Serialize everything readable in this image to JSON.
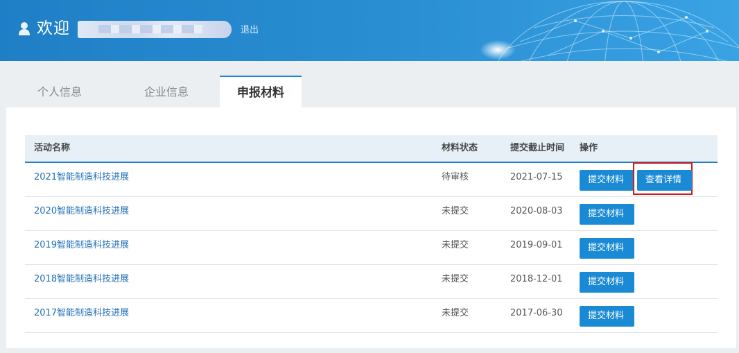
{
  "header": {
    "welcome_text": "欢迎",
    "logout_label": "退出",
    "user_icon": "user-icon"
  },
  "tabs": [
    {
      "label": "个人信息",
      "active": false
    },
    {
      "label": "企业信息",
      "active": false
    },
    {
      "label": "申报材料",
      "active": true
    }
  ],
  "table": {
    "headers": {
      "name": "活动名称",
      "status": "材料状态",
      "deadline": "提交截止时间",
      "action": "操作"
    },
    "rows": [
      {
        "name": "2021智能制造科技进展",
        "status": "待审核",
        "deadline": "2021-07-15",
        "submit_label": "提交材料",
        "detail_label": "查看详情"
      },
      {
        "name": "2020智能制造科技进展",
        "status": "未提交",
        "deadline": "2020-08-03",
        "submit_label": "提交材料"
      },
      {
        "name": "2019智能制造科技进展",
        "status": "未提交",
        "deadline": "2019-09-01",
        "submit_label": "提交材料"
      },
      {
        "name": "2018智能制造科技进展",
        "status": "未提交",
        "deadline": "2018-12-01",
        "submit_label": "提交材料"
      },
      {
        "name": "2017智能制造科技进展",
        "status": "未提交",
        "deadline": "2017-06-30",
        "submit_label": "提交材料"
      }
    ]
  },
  "colors": {
    "header_blue": "#1f7fc6",
    "button_blue": "#1a8ad4",
    "link_blue": "#1f6fb7",
    "highlight_red": "#d0191b"
  }
}
